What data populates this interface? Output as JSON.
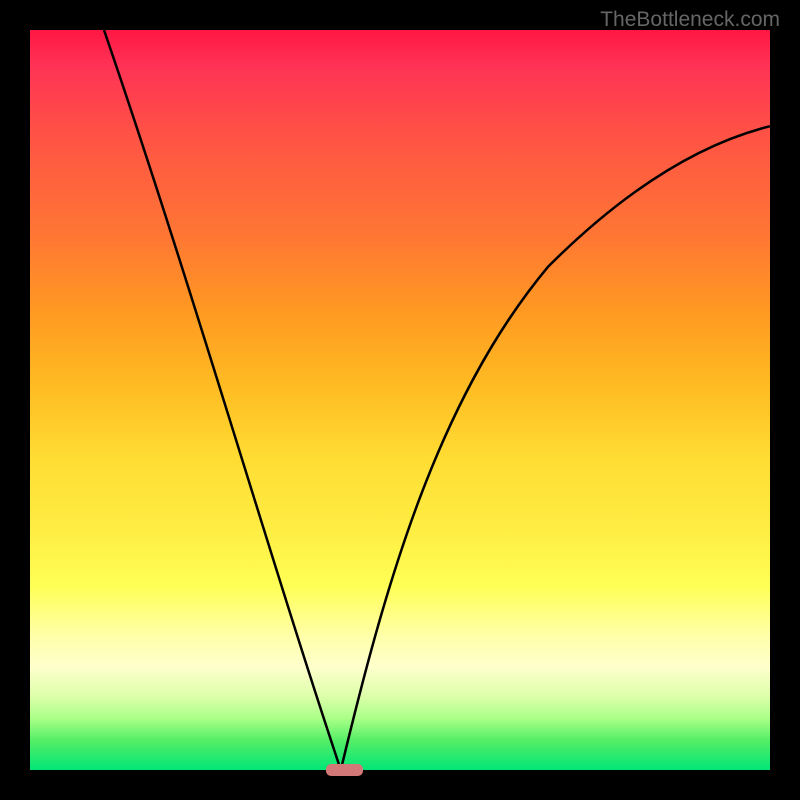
{
  "watermark": "TheBottleneck.com",
  "chart_data": {
    "type": "line",
    "title": "",
    "xlabel": "",
    "ylabel": "",
    "x_range": [
      0,
      100
    ],
    "y_range": [
      0,
      100
    ],
    "minimum_x": 42,
    "marker": {
      "x_start": 40,
      "x_end": 45,
      "color": "#d27878"
    },
    "curve_left": [
      {
        "x": 10,
        "y": 100
      },
      {
        "x": 15,
        "y": 88
      },
      {
        "x": 20,
        "y": 73
      },
      {
        "x": 25,
        "y": 58
      },
      {
        "x": 30,
        "y": 42
      },
      {
        "x": 35,
        "y": 25
      },
      {
        "x": 40,
        "y": 8
      },
      {
        "x": 42,
        "y": 0
      }
    ],
    "curve_right": [
      {
        "x": 42,
        "y": 0
      },
      {
        "x": 45,
        "y": 10
      },
      {
        "x": 50,
        "y": 25
      },
      {
        "x": 55,
        "y": 38
      },
      {
        "x": 60,
        "y": 48
      },
      {
        "x": 65,
        "y": 57
      },
      {
        "x": 70,
        "y": 64
      },
      {
        "x": 75,
        "y": 70
      },
      {
        "x": 80,
        "y": 75
      },
      {
        "x": 85,
        "y": 79
      },
      {
        "x": 90,
        "y": 82
      },
      {
        "x": 95,
        "y": 85
      },
      {
        "x": 100,
        "y": 87
      }
    ],
    "gradient_colors": {
      "top": "#ff1744",
      "middle": "#ffee44",
      "bottom": "#00e676"
    }
  }
}
